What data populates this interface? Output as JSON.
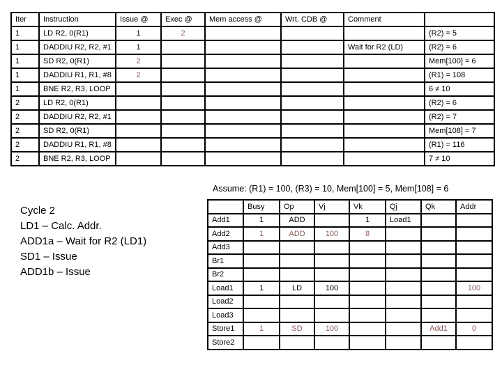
{
  "instruction_table": {
    "headers": [
      "Iter",
      "Instruction",
      "Issue @",
      "Exec @",
      "Mem access @",
      "Wrt. CDB @",
      "Comment",
      ""
    ],
    "rows": [
      {
        "iter": "1",
        "instruction": "LD R2, 0(R1)",
        "issue": "1",
        "exec": "2",
        "mem": "",
        "wrt": "",
        "comment": "",
        "result": "(R2) = 5",
        "highlight": [
          "exec"
        ]
      },
      {
        "iter": "1",
        "instruction": "DADDIU R2, R2, #1",
        "issue": "1",
        "exec": "",
        "mem": "",
        "wrt": "",
        "comment": "Wait for R2 (LD)",
        "result": "(R2) = 6",
        "highlight": []
      },
      {
        "iter": "1",
        "instruction": "SD R2, 0(R1)",
        "issue": "2",
        "exec": "",
        "mem": "",
        "wrt": "",
        "comment": "",
        "result": "Mem[100] = 6",
        "highlight": [
          "issue"
        ]
      },
      {
        "iter": "1",
        "instruction": "DADDIU R1, R1, #8",
        "issue": "2",
        "exec": "",
        "mem": "",
        "wrt": "",
        "comment": "",
        "result": "(R1) = 108",
        "highlight": [
          "issue"
        ]
      },
      {
        "iter": "1",
        "instruction": "BNE R2, R3, LOOP",
        "issue": "",
        "exec": "",
        "mem": "",
        "wrt": "",
        "comment": "",
        "result": "6 ≠ 10",
        "highlight": []
      },
      {
        "iter": "2",
        "instruction": "LD R2, 0(R1)",
        "issue": "",
        "exec": "",
        "mem": "",
        "wrt": "",
        "comment": "",
        "result": "(R2) = 6",
        "highlight": []
      },
      {
        "iter": "2",
        "instruction": "DADDIU R2, R2, #1",
        "issue": "",
        "exec": "",
        "mem": "",
        "wrt": "",
        "comment": "",
        "result": "(R2) = 7",
        "highlight": []
      },
      {
        "iter": "2",
        "instruction": "SD R2, 0(R1)",
        "issue": "",
        "exec": "",
        "mem": "",
        "wrt": "",
        "comment": "",
        "result": "Mem[108] = 7",
        "highlight": []
      },
      {
        "iter": "2",
        "instruction": "DADDIU R1, R1, #8",
        "issue": "",
        "exec": "",
        "mem": "",
        "wrt": "",
        "comment": "",
        "result": "(R1) = 116",
        "highlight": []
      },
      {
        "iter": "2",
        "instruction": "BNE R2, R3, LOOP",
        "issue": "",
        "exec": "",
        "mem": "",
        "wrt": "",
        "comment": "",
        "result": "7 ≠ 10",
        "highlight": []
      }
    ]
  },
  "assumption": "Assume: (R1) = 100, (R3) = 10, Mem[100] = 5, Mem[108] = 6",
  "notes": [
    "Cycle 2",
    "LD1 – Calc. Addr.",
    "ADD1a – Wait for R2 (LD1)",
    "SD1 – Issue",
    "ADD1b – Issue"
  ],
  "reservation_table": {
    "headers": [
      "",
      "Busy",
      "Op",
      "Vj",
      "Vk",
      "Qj",
      "Qk",
      "Addr"
    ],
    "rows": [
      {
        "name": "Add1",
        "busy": "1",
        "op": "ADD",
        "vj": "",
        "vk": "1",
        "qj": "Load1",
        "qk": "",
        "addr": "",
        "highlight": false
      },
      {
        "name": "Add2",
        "busy": "1",
        "op": "ADD",
        "vj": "100",
        "vk": "8",
        "qj": "",
        "qk": "",
        "addr": "",
        "highlight": true
      },
      {
        "name": "Add3",
        "busy": "",
        "op": "",
        "vj": "",
        "vk": "",
        "qj": "",
        "qk": "",
        "addr": "",
        "highlight": false
      },
      {
        "name": "Br1",
        "busy": "",
        "op": "",
        "vj": "",
        "vk": "",
        "qj": "",
        "qk": "",
        "addr": "",
        "highlight": false
      },
      {
        "name": "Br2",
        "busy": "",
        "op": "",
        "vj": "",
        "vk": "",
        "qj": "",
        "qk": "",
        "addr": "",
        "highlight": false
      },
      {
        "name": "Load1",
        "busy": "1",
        "op": "LD",
        "vj": "100",
        "vk": "",
        "qj": "",
        "qk": "",
        "addr": "100",
        "highlight": false,
        "highlight_cols": [
          "addr"
        ]
      },
      {
        "name": "Load2",
        "busy": "",
        "op": "",
        "vj": "",
        "vk": "",
        "qj": "",
        "qk": "",
        "addr": "",
        "highlight": false
      },
      {
        "name": "Load3",
        "busy": "",
        "op": "",
        "vj": "",
        "vk": "",
        "qj": "",
        "qk": "",
        "addr": "",
        "highlight": false
      },
      {
        "name": "Store1",
        "busy": "1",
        "op": "SD",
        "vj": "100",
        "vk": "",
        "qj": "",
        "qk": "Add1",
        "addr": "0",
        "highlight": true
      },
      {
        "name": "Store2",
        "busy": "",
        "op": "",
        "vj": "",
        "vk": "",
        "qj": "",
        "qk": "",
        "addr": "",
        "highlight": false
      }
    ]
  },
  "colors": {
    "highlight": "#8a5a5a",
    "text": "#000000"
  }
}
